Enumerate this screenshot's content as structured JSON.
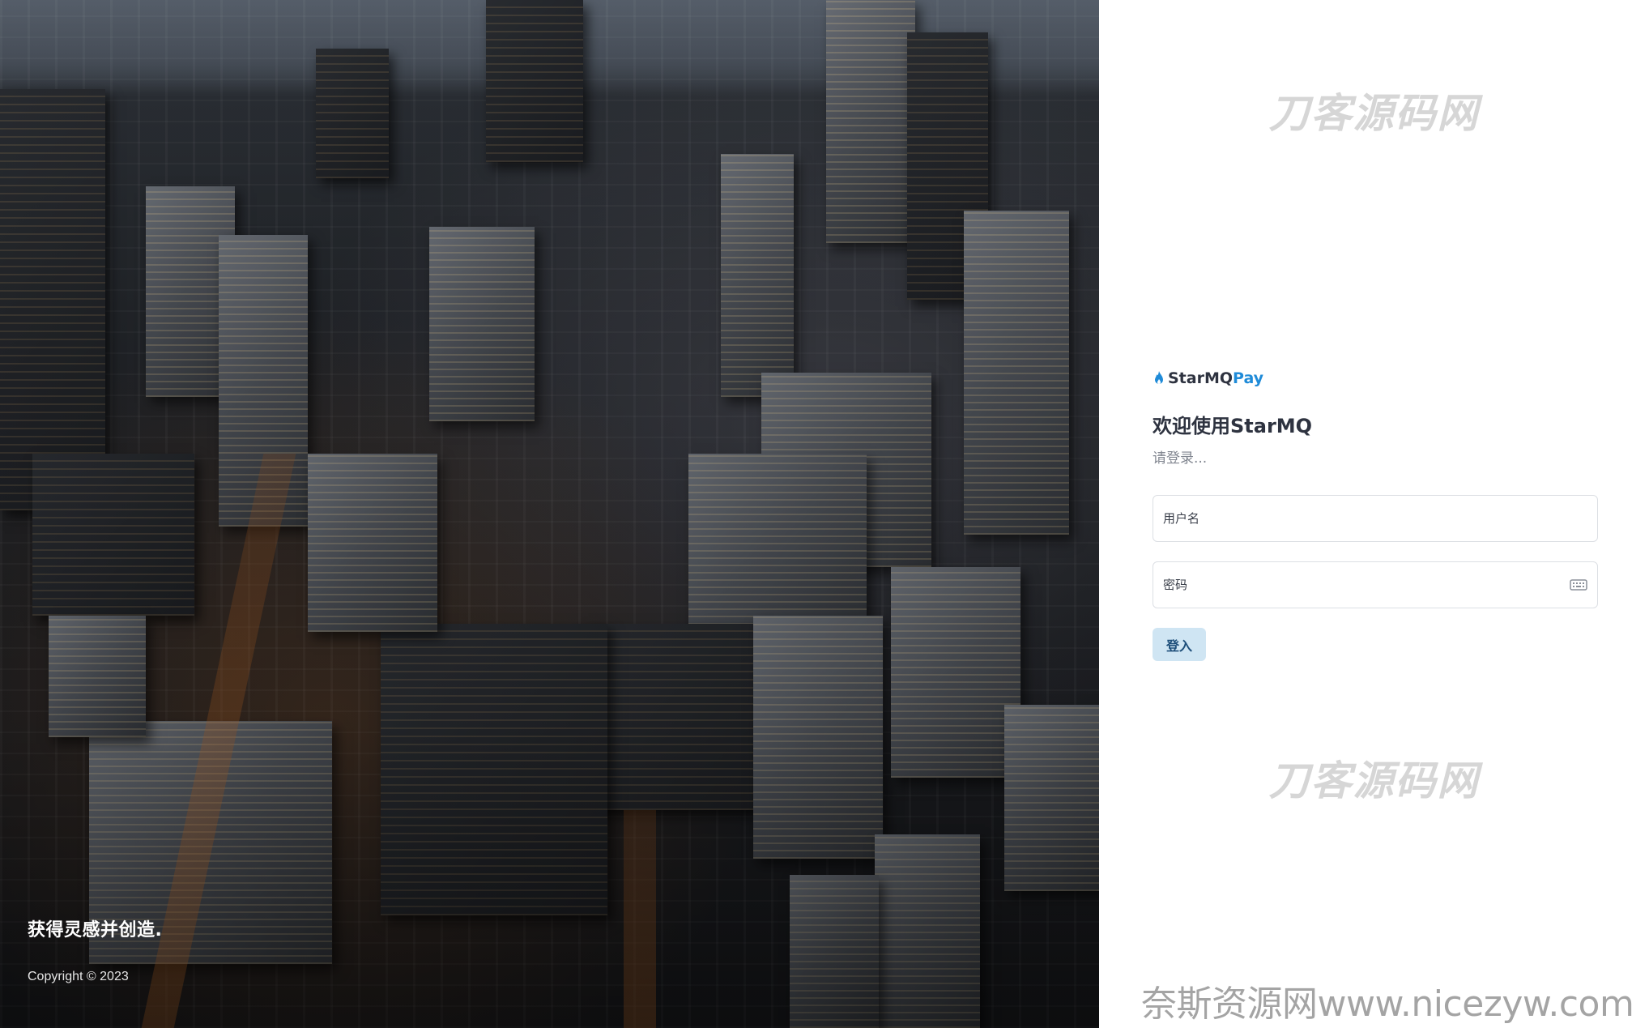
{
  "hero": {
    "tagline": "获得灵感并创造.",
    "copyright": "Copyright © 2023"
  },
  "watermarks": {
    "top": "刀客源码网",
    "bottom": "刀客源码网",
    "site": "奈斯资源网www.nicezyw.com"
  },
  "login": {
    "brand_name": "StarMQ",
    "brand_suffix": "Pay",
    "brand_icon": "flame-icon",
    "welcome": "欢迎使用StarMQ",
    "subtitle": "请登录...",
    "username_placeholder": "用户名",
    "password_placeholder": "密码",
    "password_icon": "keyboard-icon",
    "submit_label": "登入"
  },
  "colors": {
    "accent": "#1f8bd8",
    "button_bg": "#cfe5f3",
    "button_text": "#1d4e7a",
    "heading": "#2e3340"
  }
}
